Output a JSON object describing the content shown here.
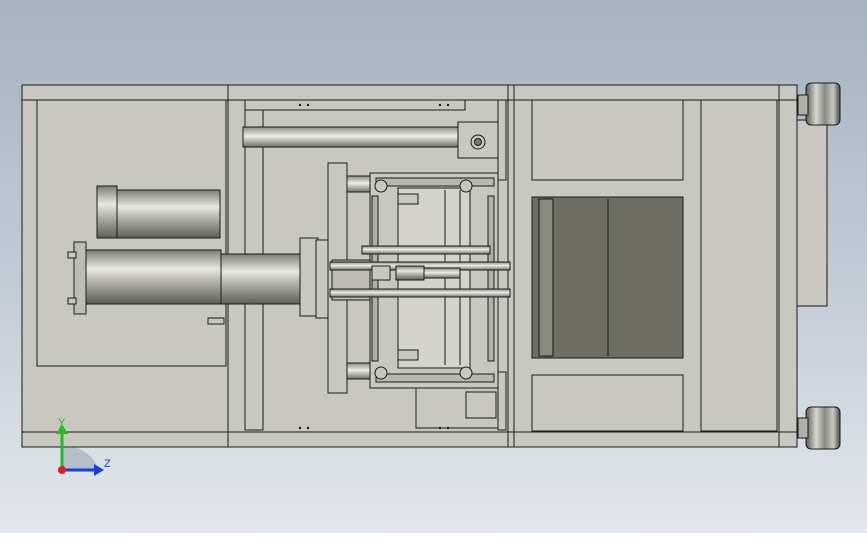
{
  "colors": {
    "background_top": "#a7b2c0",
    "background_bottom": "#e3e7ec",
    "metal": "#c8c8c0",
    "outline": "#1a1a1a",
    "dark_panel": "#6e6e64",
    "axis_y": "#22bb22",
    "axis_z": "#1a3fd6",
    "axis_origin": "#e02020"
  },
  "triad": {
    "y_label": "Y",
    "z_label": "Z"
  }
}
